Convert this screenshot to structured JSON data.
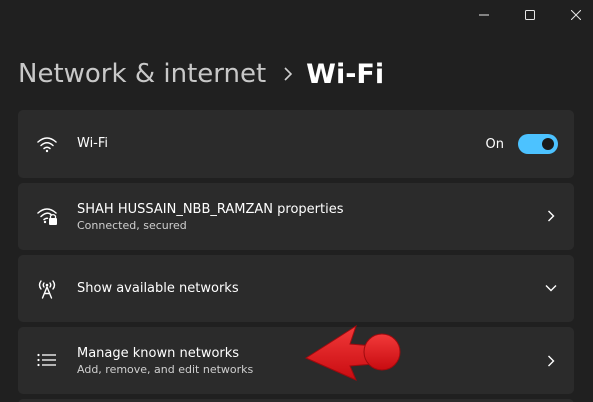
{
  "window": {
    "controls": {
      "minimize_icon": "minimize-icon",
      "maximize_icon": "maximize-icon",
      "close_icon": "close-icon"
    }
  },
  "header": {
    "parent": "Network & internet",
    "separator_icon": "chevron-right-icon",
    "current": "Wi-Fi"
  },
  "settings": {
    "wifi": {
      "icon": "wifi-icon",
      "title": "Wi-Fi",
      "toggle_label": "On",
      "toggle_on": true
    },
    "properties": {
      "icon": "wifi-secure-icon",
      "title": "SHAH HUSSAIN_NBB_RAMZAN properties",
      "subtitle": "Connected, secured"
    },
    "available": {
      "icon": "antenna-icon",
      "title": "Show available networks"
    },
    "known": {
      "icon": "list-icon",
      "title": "Manage known networks",
      "subtitle": "Add, remove, and edit networks"
    }
  },
  "colors": {
    "background": "#202020",
    "card": "#2b2b2b",
    "accent": "#4cc2ff",
    "annotation": "#e8151b"
  }
}
